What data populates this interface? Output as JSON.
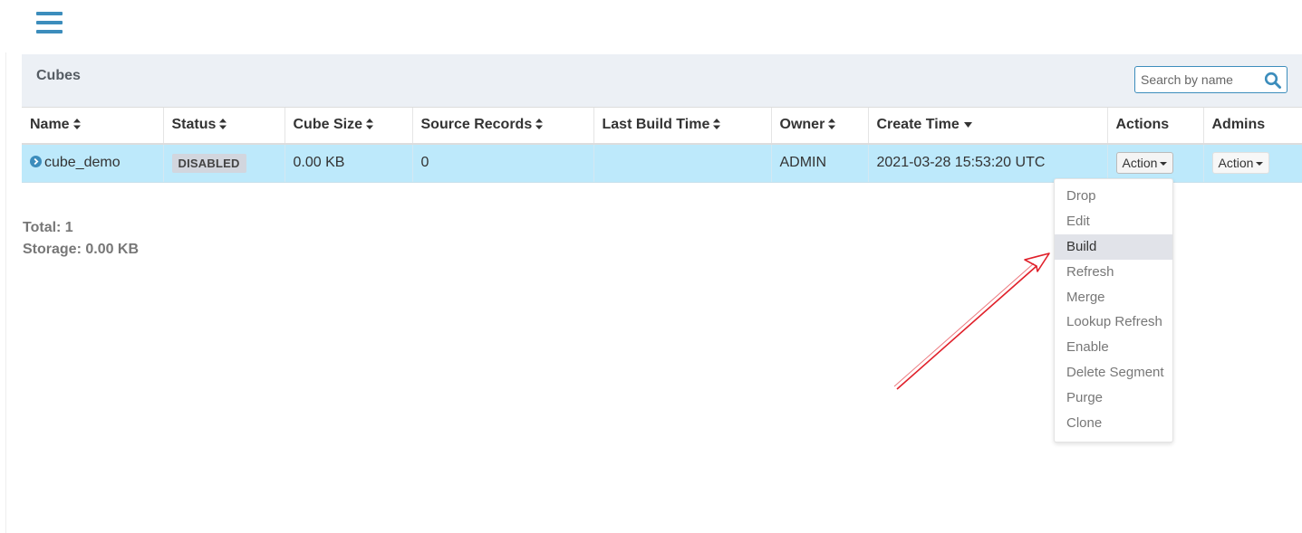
{
  "header": {
    "menu_icon": "hamburger-menu-icon"
  },
  "panel": {
    "title": "Cubes",
    "search": {
      "placeholder": "Search by name",
      "value": "",
      "icon": "search-icon"
    }
  },
  "table": {
    "columns": [
      {
        "label": "Name",
        "sort": "both"
      },
      {
        "label": "Status",
        "sort": "both"
      },
      {
        "label": "Cube Size",
        "sort": "both"
      },
      {
        "label": "Source Records",
        "sort": "both"
      },
      {
        "label": "Last Build Time",
        "sort": "both"
      },
      {
        "label": "Owner",
        "sort": "both"
      },
      {
        "label": "Create Time",
        "sort": "desc"
      },
      {
        "label": "Actions",
        "sort": "none"
      },
      {
        "label": "Admins",
        "sort": "none"
      }
    ],
    "rows": [
      {
        "name": "cube_demo",
        "status": "DISABLED",
        "cube_size": "0.00 KB",
        "source_records": "0",
        "last_build_time": "",
        "owner": "ADMIN",
        "create_time": "2021-03-28 15:53:20 UTC",
        "actions_label": "Action",
        "admins_label": "Action"
      }
    ]
  },
  "summary": {
    "total": "Total: 1",
    "storage": "Storage: 0.00 KB"
  },
  "action_menu": {
    "items": [
      "Drop",
      "Edit",
      "Build",
      "Refresh",
      "Merge",
      "Lookup Refresh",
      "Enable",
      "Delete Segment",
      "Purge",
      "Clone"
    ],
    "highlighted": "Build"
  },
  "colors": {
    "accent": "#3c8dbc",
    "row_selected": "#bde9fb",
    "panel_header": "#ecf0f5",
    "annotation_arrow": "#e0202a"
  }
}
